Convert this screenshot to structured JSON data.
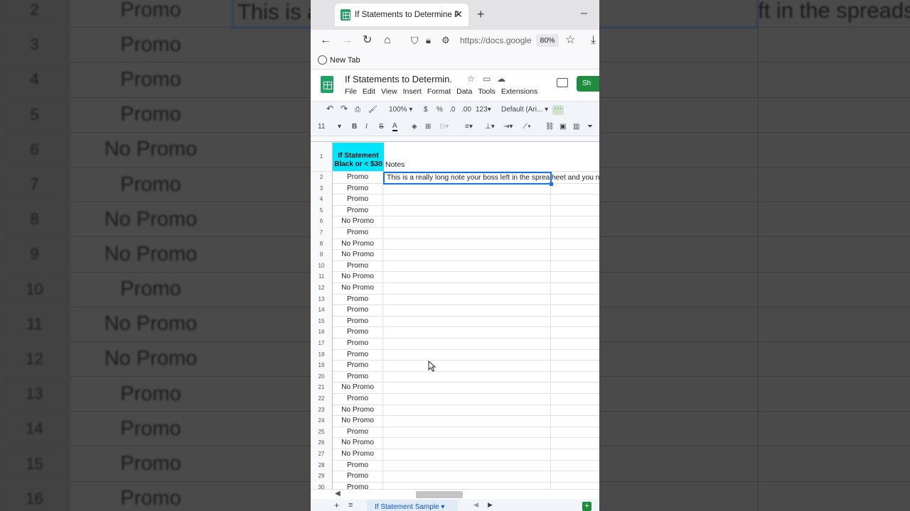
{
  "background": {
    "row_numbers": [
      "2",
      "3",
      "4",
      "5",
      "6",
      "7",
      "8",
      "9",
      "10",
      "11",
      "12",
      "13",
      "14",
      "15",
      "16"
    ],
    "values": [
      "Promo",
      "Promo",
      "Promo",
      "Promo",
      "No Promo",
      "Promo",
      "No Promo",
      "No Promo",
      "Promo",
      "No Promo",
      "No Promo",
      "Promo",
      "Promo",
      "Promo",
      "Promo"
    ],
    "note_fragment_left": "This is a",
    "note_fragment_right": "ft in the spreadsheet and you ne"
  },
  "browser": {
    "tab_title": "If Statements to Determine Pro",
    "url": "https://docs.google",
    "zoom": "80%",
    "bookmark": "New Tab"
  },
  "sheets": {
    "doc_title": "If Statements to Determin...",
    "menu": [
      "File",
      "Edit",
      "View",
      "Insert",
      "Format",
      "Data",
      "Tools",
      "Extensions"
    ],
    "share_label": "Sh",
    "zoom": "100%",
    "currency": "$",
    "percent": "%",
    "dec_decrease": ".0",
    "dec_increase": ".00",
    "number_format": "123",
    "font": "Default (Ari...",
    "font_size": "11",
    "bold": "B",
    "italic": "I",
    "strike": "S",
    "text_color": "A",
    "more": "···"
  },
  "grid": {
    "header_row_number": "1",
    "header_cell_line1": "If Statement",
    "header_cell_line2": "Black or < $30",
    "notes_header": "Notes",
    "note_text": "This is a really long note your boss left in the spreads",
    "note_tail": "heet and you ne",
    "rows": [
      {
        "n": "2",
        "v": "Promo"
      },
      {
        "n": "3",
        "v": "Promo"
      },
      {
        "n": "4",
        "v": "Promo"
      },
      {
        "n": "5",
        "v": "Promo"
      },
      {
        "n": "6",
        "v": "No Promo"
      },
      {
        "n": "7",
        "v": "Promo"
      },
      {
        "n": "8",
        "v": "No Promo"
      },
      {
        "n": "9",
        "v": "No Promo"
      },
      {
        "n": "10",
        "v": "Promo"
      },
      {
        "n": "11",
        "v": "No Promo"
      },
      {
        "n": "12",
        "v": "No Promo"
      },
      {
        "n": "13",
        "v": "Promo"
      },
      {
        "n": "14",
        "v": "Promo"
      },
      {
        "n": "15",
        "v": "Promo"
      },
      {
        "n": "16",
        "v": "Promo"
      },
      {
        "n": "17",
        "v": "Promo"
      },
      {
        "n": "18",
        "v": "Promo"
      },
      {
        "n": "19",
        "v": "Promo"
      },
      {
        "n": "20",
        "v": "Promo"
      },
      {
        "n": "21",
        "v": "No Promo"
      },
      {
        "n": "22",
        "v": "Promo"
      },
      {
        "n": "23",
        "v": "No Promo"
      },
      {
        "n": "24",
        "v": "No Promo"
      },
      {
        "n": "25",
        "v": "Promo"
      },
      {
        "n": "26",
        "v": "No Promo"
      },
      {
        "n": "27",
        "v": "No Promo"
      },
      {
        "n": "28",
        "v": "Promo"
      },
      {
        "n": "29",
        "v": "Promo"
      },
      {
        "n": "30",
        "v": "Promo"
      }
    ]
  },
  "bottom": {
    "sheet_tab": "If Statement Sample"
  },
  "colors": {
    "header_cell": "#00e5ff",
    "selection": "#1a73e8",
    "sheets_green": "#1e8e3e"
  }
}
